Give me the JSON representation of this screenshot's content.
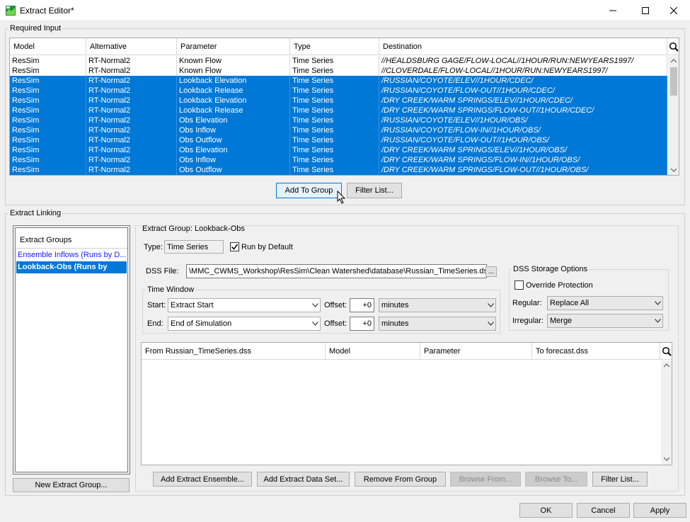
{
  "window": {
    "title": "Extract Editor*"
  },
  "required_input": {
    "label": "Required Input",
    "columns": [
      "Model",
      "Alternative",
      "Parameter",
      "Type",
      "Destination"
    ],
    "rows": [
      {
        "model": "ResSim",
        "alt": "RT-Normal2",
        "param": "Known Flow",
        "type": "Time Series",
        "dest": "//HEALDSBURG GAGE/FLOW-LOCAL//1HOUR/RUN:NEWYEARS1997/",
        "selected": false
      },
      {
        "model": "ResSim",
        "alt": "RT-Normal2",
        "param": "Known Flow",
        "type": "Time Series",
        "dest": "//CLOVERDALE/FLOW-LOCAL//1HOUR/RUN:NEWYEARS1997/",
        "selected": false
      },
      {
        "model": "ResSim",
        "alt": "RT-Normal2",
        "param": "Lookback Elevation",
        "type": "Time Series",
        "dest": "/RUSSIAN/COYOTE/ELEV//1HOUR/CDEC/",
        "selected": true
      },
      {
        "model": "ResSim",
        "alt": "RT-Normal2",
        "param": "Lookback Release",
        "type": "Time Series",
        "dest": "/RUSSIAN/COYOTE/FLOW-OUT//1HOUR/CDEC/",
        "selected": true
      },
      {
        "model": "ResSim",
        "alt": "RT-Normal2",
        "param": "Lookback Elevation",
        "type": "Time Series",
        "dest": "/DRY CREEK/WARM SPRINGS/ELEV//1HOUR/CDEC/",
        "selected": true
      },
      {
        "model": "ResSim",
        "alt": "RT-Normal2",
        "param": "Lookback Release",
        "type": "Time Series",
        "dest": "/DRY CREEK/WARM SPRINGS/FLOW-OUT//1HOUR/CDEC/",
        "selected": true
      },
      {
        "model": "ResSim",
        "alt": "RT-Normal2",
        "param": "Obs Elevation",
        "type": "Time Series",
        "dest": "/RUSSIAN/COYOTE/ELEV//1HOUR/OBS/",
        "selected": true
      },
      {
        "model": "ResSim",
        "alt": "RT-Normal2",
        "param": "Obs Inflow",
        "type": "Time Series",
        "dest": "/RUSSIAN/COYOTE/FLOW-IN//1HOUR/OBS/",
        "selected": true
      },
      {
        "model": "ResSim",
        "alt": "RT-Normal2",
        "param": "Obs Outflow",
        "type": "Time Series",
        "dest": "/RUSSIAN/COYOTE/FLOW-OUT//1HOUR/OBS/",
        "selected": true
      },
      {
        "model": "ResSim",
        "alt": "RT-Normal2",
        "param": "Obs Elevation",
        "type": "Time Series",
        "dest": "/DRY CREEK/WARM SPRINGS/ELEV//1HOUR/OBS/",
        "selected": true
      },
      {
        "model": "ResSim",
        "alt": "RT-Normal2",
        "param": "Obs Inflow",
        "type": "Time Series",
        "dest": "/DRY CREEK/WARM SPRINGS/FLOW-IN//1HOUR/OBS/",
        "selected": true
      },
      {
        "model": "ResSim",
        "alt": "RT-Normal2",
        "param": "Obs Outflow",
        "type": "Time Series",
        "dest": "/DRY CREEK/WARM SPRINGS/FLOW-OUT//1HOUR/OBS/",
        "selected": true
      }
    ],
    "add_to_group_label": "Add To Group",
    "filter_list_label": "Filter List..."
  },
  "extract_linking": {
    "label": "Extract Linking",
    "groups_header": "Extract Groups",
    "groups": [
      {
        "label": "Ensemble Inflows (Runs by D...",
        "selected": false
      },
      {
        "label": "Lookback-Obs (Runs by",
        "selected": true
      }
    ],
    "new_group_label": "New Extract Group...",
    "group_title": "Extract Group: Lookback-Obs",
    "type_label": "Type:",
    "type_value": "Time Series",
    "run_by_default_label": "Run by Default",
    "run_by_default_checked": true,
    "dss_file_label": "DSS File:",
    "dss_file_value": "\\MMC_CWMS_Workshop\\ResSim\\Clean Watershed\\database\\Russian_TimeSeries.dss",
    "browse_label": "...",
    "time_window": {
      "label": "Time Window",
      "start_label": "Start:",
      "start_value": "Extract Start",
      "end_label": "End:",
      "end_value": "End of Simulation",
      "offset_label": "Offset:",
      "start_offset": "+0",
      "end_offset": "+0",
      "start_units": "minutes",
      "end_units": "minutes"
    },
    "storage": {
      "label": "DSS Storage Options",
      "override_label": "Override Protection",
      "override_checked": false,
      "regular_label": "Regular:",
      "regular_value": "Replace All",
      "irregular_label": "Irregular:",
      "irregular_value": "Merge"
    },
    "link_table_columns": [
      "From Russian_TimeSeries.dss",
      "Model",
      "Parameter",
      "To forecast.dss"
    ],
    "buttons": {
      "add_ensemble": "Add Extract Ensemble...",
      "add_data_set": "Add Extract Data Set...",
      "remove": "Remove From Group",
      "browse_from": "Browse From...",
      "browse_to": "Browse To...",
      "filter_list": "Filter List..."
    }
  },
  "footer": {
    "ok": "OK",
    "cancel": "Cancel",
    "apply": "Apply"
  },
  "colors": {
    "selection": "#0078d7",
    "accent_link": "#1a1aff"
  }
}
